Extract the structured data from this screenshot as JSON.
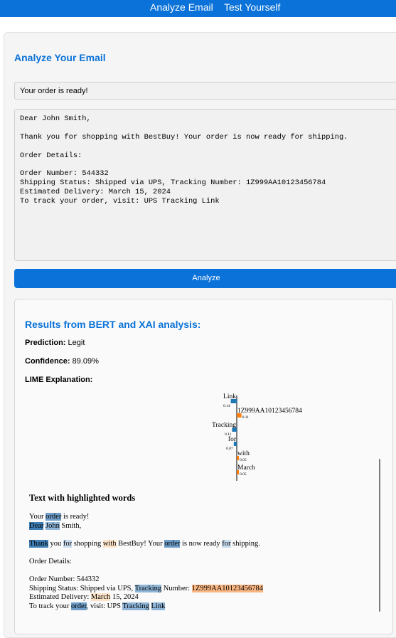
{
  "nav": {
    "analyze": "Analyze Email",
    "test": "Test Yourself"
  },
  "form": {
    "title": "Analyze Your Email",
    "subject": "Your order is ready!",
    "body": "Dear John Smith,\n\nThank you for shopping with BestBuy! Your order is now ready for shipping.\n\nOrder Details:\n\nOrder Number: 544332\nShipping Status: Shipped via UPS, Tracking Number: 1Z999AA10123456784\nEstimated Delivery: March 15, 2024\nTo track your order, visit: UPS Tracking Link",
    "analyze_label": "Analyze"
  },
  "results": {
    "title": "Results from BERT and XAI analysis:",
    "prediction_label": "Prediction:",
    "prediction_value": "Legit",
    "confidence_label": "Confidence:",
    "confidence_value": "89.09%",
    "lime_label": "LIME Explanation:"
  },
  "chart_data": {
    "type": "bar",
    "orientation": "horizontal",
    "categories": [
      "Link",
      "1Z999AA10123456784",
      "Tracking",
      "for",
      "with",
      "March"
    ],
    "values": [
      -0.14,
      0.11,
      -0.11,
      -0.07,
      0.05,
      0.05
    ],
    "labels": [
      "0.14",
      "0.11",
      "0.11",
      "0.07",
      "0.05",
      "0.05"
    ],
    "colors": {
      "negative": "#1f77b4",
      "positive": "#ff7f0e"
    }
  },
  "highlight": {
    "title": "Text with highlighted words",
    "lines": [
      [
        {
          "t": "Your "
        },
        {
          "t": "order",
          "c": "#6f9fc8"
        },
        {
          "t": " is ready!"
        }
      ],
      [
        {
          "t": "Dear",
          "c": "#3f7fb5"
        },
        {
          "t": " "
        },
        {
          "t": "John",
          "c": "#8fb6d8"
        },
        {
          "t": " Smith,"
        }
      ],
      [],
      [
        {
          "t": "Thank",
          "c": "#3f7fb5"
        },
        {
          "t": " you "
        },
        {
          "t": "for",
          "c": "#c9dcee"
        },
        {
          "t": " shopping "
        },
        {
          "t": "with",
          "c": "#fde4c8"
        },
        {
          "t": " BestBuy! Your "
        },
        {
          "t": "order",
          "c": "#6f9fc8"
        },
        {
          "t": " is now ready "
        },
        {
          "t": "for",
          "c": "#c9dcee"
        },
        {
          "t": " shipping."
        }
      ],
      [],
      [
        {
          "t": "Order Details:"
        }
      ],
      [],
      [
        {
          "t": "Order Number: 544332"
        }
      ],
      [
        {
          "t": "Shipping Status: Shipped via UPS, "
        },
        {
          "t": "Tracking",
          "c": "#8fb6d8"
        },
        {
          "t": " Number: "
        },
        {
          "t": "1Z999AA10123456784",
          "c": "#fbb884"
        }
      ],
      [
        {
          "t": "Estimated Delivery: "
        },
        {
          "t": "March",
          "c": "#fde4c8"
        },
        {
          "t": " 15, 2024"
        }
      ],
      [
        {
          "t": "To track your "
        },
        {
          "t": "order",
          "c": "#6f9fc8"
        },
        {
          "t": ", visit: UPS "
        },
        {
          "t": "Tracking",
          "c": "#8fb6d8"
        },
        {
          "t": " "
        },
        {
          "t": "Link",
          "c": "#8fb6d8"
        }
      ]
    ]
  }
}
